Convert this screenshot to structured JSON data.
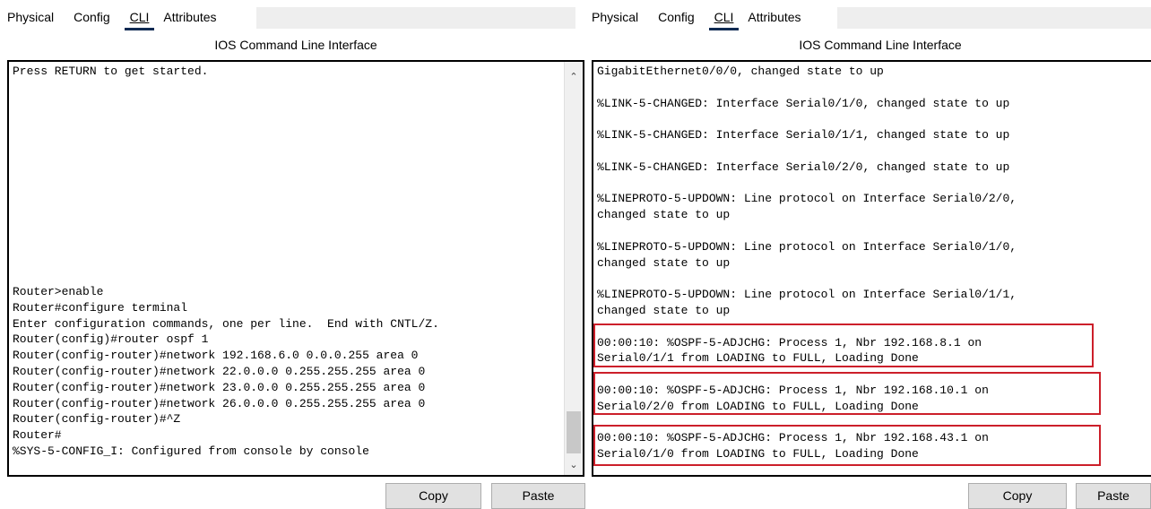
{
  "tabs": [
    "Physical",
    "Config",
    "CLI",
    "Attributes"
  ],
  "active_tab": "CLI",
  "header_title": "IOS Command Line Interface",
  "left": {
    "console_top": "Press RETURN to get started.",
    "console_bottom": "Router>enable\nRouter#configure terminal\nEnter configuration commands, one per line.  End with CNTL/Z.\nRouter(config)#router ospf 1\nRouter(config-router)#network 192.168.6.0 0.0.0.255 area 0\nRouter(config-router)#network 22.0.0.0 0.255.255.255 area 0\nRouter(config-router)#network 23.0.0.0 0.255.255.255 area 0\nRouter(config-router)#network 26.0.0.0 0.255.255.255 area 0\nRouter(config-router)#^Z\nRouter#\n%SYS-5-CONFIG_I: Configured from console by console"
  },
  "right": {
    "log_lines": [
      "GigabitEthernet0/0/0, changed state to up",
      "",
      "%LINK-5-CHANGED: Interface Serial0/1/0, changed state to up",
      "",
      "%LINK-5-CHANGED: Interface Serial0/1/1, changed state to up",
      "",
      "%LINK-5-CHANGED: Interface Serial0/2/0, changed state to up",
      "",
      "%LINEPROTO-5-UPDOWN: Line protocol on Interface Serial0/2/0,\nchanged state to up",
      "",
      "%LINEPROTO-5-UPDOWN: Line protocol on Interface Serial0/1/0,\nchanged state to up",
      "",
      "%LINEPROTO-5-UPDOWN: Line protocol on Interface Serial0/1/1,\nchanged state to up",
      "",
      "00:00:10: %OSPF-5-ADJCHG: Process 1, Nbr 192.168.8.1 on\nSerial0/1/1 from LOADING to FULL, Loading Done",
      "",
      "00:00:10: %OSPF-5-ADJCHG: Process 1, Nbr 192.168.10.1 on\nSerial0/2/0 from LOADING to FULL, Loading Done",
      "",
      "00:00:10: %OSPF-5-ADJCHG: Process 1, Nbr 192.168.43.1 on\nSerial0/1/0 from LOADING to FULL, Loading Done"
    ]
  },
  "buttons": {
    "copy": "Copy",
    "paste": "Paste"
  },
  "colors": {
    "highlight_box": "#cc1f2a",
    "tab_underline": "#0f2a52"
  },
  "icons": {
    "scroll_up": "chevron-up-icon",
    "scroll_down": "chevron-down-icon"
  }
}
